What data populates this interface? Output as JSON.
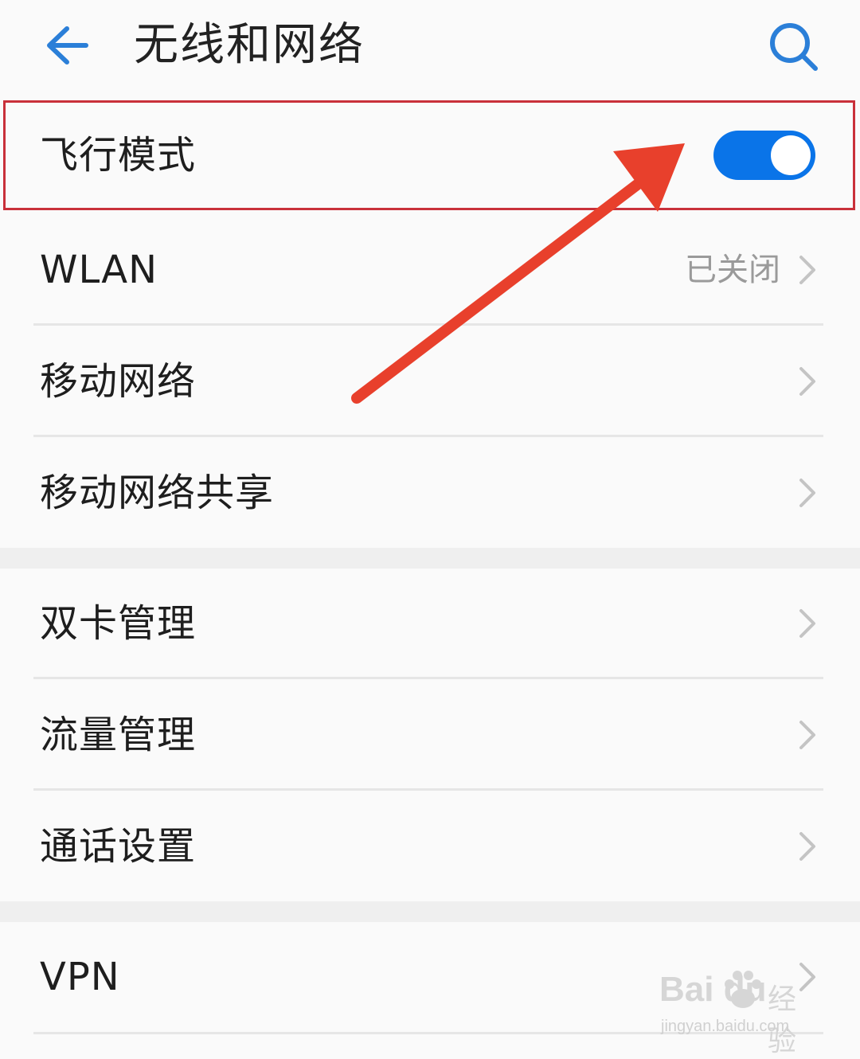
{
  "header": {
    "title": "无线和网络"
  },
  "airplane": {
    "label": "飞行模式",
    "toggle_on": true
  },
  "items": [
    {
      "label": "WLAN",
      "value": "已关闭"
    },
    {
      "label": "移动网络"
    },
    {
      "label": "移动网络共享"
    },
    {
      "label": "双卡管理"
    },
    {
      "label": "流量管理"
    },
    {
      "label": "通话设置"
    },
    {
      "label": "VPN"
    }
  ],
  "colors": {
    "accent": "#0a74e8",
    "highlight_border": "#c9303a",
    "annotation_arrow": "#e8402c"
  },
  "watermark": {
    "logo_text": "Bai  du",
    "cn_text": "经验",
    "url": "jingyan.baidu.com"
  }
}
